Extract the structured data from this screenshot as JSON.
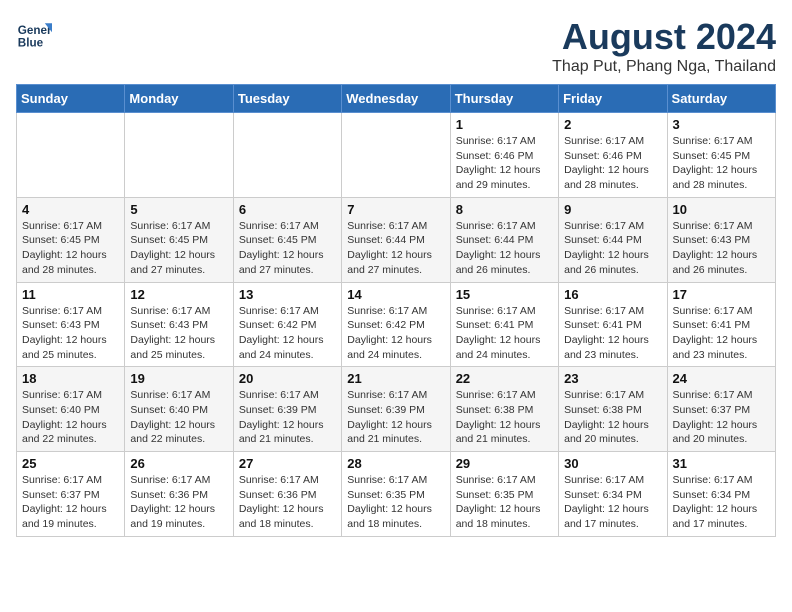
{
  "logo": {
    "line1": "General",
    "line2": "Blue"
  },
  "title": "August 2024",
  "subtitle": "Thap Put, Phang Nga, Thailand",
  "days_header": [
    "Sunday",
    "Monday",
    "Tuesday",
    "Wednesday",
    "Thursday",
    "Friday",
    "Saturday"
  ],
  "weeks": [
    [
      {
        "day": "",
        "detail": ""
      },
      {
        "day": "",
        "detail": ""
      },
      {
        "day": "",
        "detail": ""
      },
      {
        "day": "",
        "detail": ""
      },
      {
        "day": "1",
        "detail": "Sunrise: 6:17 AM\nSunset: 6:46 PM\nDaylight: 12 hours\nand 29 minutes."
      },
      {
        "day": "2",
        "detail": "Sunrise: 6:17 AM\nSunset: 6:46 PM\nDaylight: 12 hours\nand 28 minutes."
      },
      {
        "day": "3",
        "detail": "Sunrise: 6:17 AM\nSunset: 6:45 PM\nDaylight: 12 hours\nand 28 minutes."
      }
    ],
    [
      {
        "day": "4",
        "detail": "Sunrise: 6:17 AM\nSunset: 6:45 PM\nDaylight: 12 hours\nand 28 minutes."
      },
      {
        "day": "5",
        "detail": "Sunrise: 6:17 AM\nSunset: 6:45 PM\nDaylight: 12 hours\nand 27 minutes."
      },
      {
        "day": "6",
        "detail": "Sunrise: 6:17 AM\nSunset: 6:45 PM\nDaylight: 12 hours\nand 27 minutes."
      },
      {
        "day": "7",
        "detail": "Sunrise: 6:17 AM\nSunset: 6:44 PM\nDaylight: 12 hours\nand 27 minutes."
      },
      {
        "day": "8",
        "detail": "Sunrise: 6:17 AM\nSunset: 6:44 PM\nDaylight: 12 hours\nand 26 minutes."
      },
      {
        "day": "9",
        "detail": "Sunrise: 6:17 AM\nSunset: 6:44 PM\nDaylight: 12 hours\nand 26 minutes."
      },
      {
        "day": "10",
        "detail": "Sunrise: 6:17 AM\nSunset: 6:43 PM\nDaylight: 12 hours\nand 26 minutes."
      }
    ],
    [
      {
        "day": "11",
        "detail": "Sunrise: 6:17 AM\nSunset: 6:43 PM\nDaylight: 12 hours\nand 25 minutes."
      },
      {
        "day": "12",
        "detail": "Sunrise: 6:17 AM\nSunset: 6:43 PM\nDaylight: 12 hours\nand 25 minutes."
      },
      {
        "day": "13",
        "detail": "Sunrise: 6:17 AM\nSunset: 6:42 PM\nDaylight: 12 hours\nand 24 minutes."
      },
      {
        "day": "14",
        "detail": "Sunrise: 6:17 AM\nSunset: 6:42 PM\nDaylight: 12 hours\nand 24 minutes."
      },
      {
        "day": "15",
        "detail": "Sunrise: 6:17 AM\nSunset: 6:41 PM\nDaylight: 12 hours\nand 24 minutes."
      },
      {
        "day": "16",
        "detail": "Sunrise: 6:17 AM\nSunset: 6:41 PM\nDaylight: 12 hours\nand 23 minutes."
      },
      {
        "day": "17",
        "detail": "Sunrise: 6:17 AM\nSunset: 6:41 PM\nDaylight: 12 hours\nand 23 minutes."
      }
    ],
    [
      {
        "day": "18",
        "detail": "Sunrise: 6:17 AM\nSunset: 6:40 PM\nDaylight: 12 hours\nand 22 minutes."
      },
      {
        "day": "19",
        "detail": "Sunrise: 6:17 AM\nSunset: 6:40 PM\nDaylight: 12 hours\nand 22 minutes."
      },
      {
        "day": "20",
        "detail": "Sunrise: 6:17 AM\nSunset: 6:39 PM\nDaylight: 12 hours\nand 21 minutes."
      },
      {
        "day": "21",
        "detail": "Sunrise: 6:17 AM\nSunset: 6:39 PM\nDaylight: 12 hours\nand 21 minutes."
      },
      {
        "day": "22",
        "detail": "Sunrise: 6:17 AM\nSunset: 6:38 PM\nDaylight: 12 hours\nand 21 minutes."
      },
      {
        "day": "23",
        "detail": "Sunrise: 6:17 AM\nSunset: 6:38 PM\nDaylight: 12 hours\nand 20 minutes."
      },
      {
        "day": "24",
        "detail": "Sunrise: 6:17 AM\nSunset: 6:37 PM\nDaylight: 12 hours\nand 20 minutes."
      }
    ],
    [
      {
        "day": "25",
        "detail": "Sunrise: 6:17 AM\nSunset: 6:37 PM\nDaylight: 12 hours\nand 19 minutes."
      },
      {
        "day": "26",
        "detail": "Sunrise: 6:17 AM\nSunset: 6:36 PM\nDaylight: 12 hours\nand 19 minutes."
      },
      {
        "day": "27",
        "detail": "Sunrise: 6:17 AM\nSunset: 6:36 PM\nDaylight: 12 hours\nand 18 minutes."
      },
      {
        "day": "28",
        "detail": "Sunrise: 6:17 AM\nSunset: 6:35 PM\nDaylight: 12 hours\nand 18 minutes."
      },
      {
        "day": "29",
        "detail": "Sunrise: 6:17 AM\nSunset: 6:35 PM\nDaylight: 12 hours\nand 18 minutes."
      },
      {
        "day": "30",
        "detail": "Sunrise: 6:17 AM\nSunset: 6:34 PM\nDaylight: 12 hours\nand 17 minutes."
      },
      {
        "day": "31",
        "detail": "Sunrise: 6:17 AM\nSunset: 6:34 PM\nDaylight: 12 hours\nand 17 minutes."
      }
    ]
  ]
}
